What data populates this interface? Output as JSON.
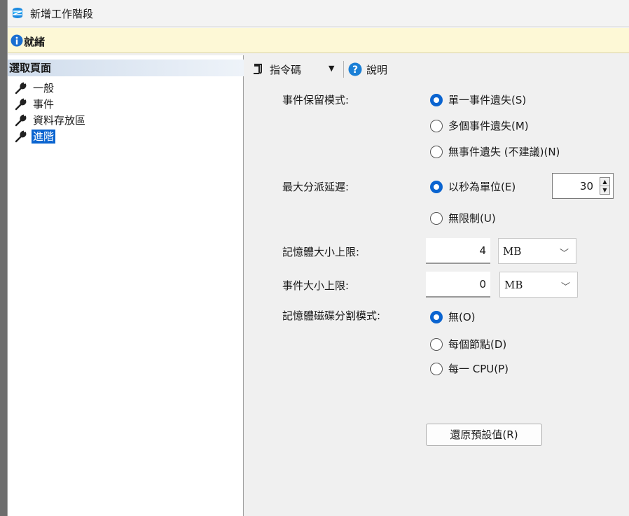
{
  "window": {
    "title": "新增工作階段"
  },
  "status": {
    "text": "就緒"
  },
  "left_pane": {
    "header": "選取頁面",
    "items": [
      {
        "label": "一般"
      },
      {
        "label": "事件"
      },
      {
        "label": "資料存放區"
      },
      {
        "label": "進階",
        "selected": true
      }
    ]
  },
  "toolbar": {
    "script_label": "指令碼",
    "help_label": "說明"
  },
  "retention": {
    "label": "事件保留模式:",
    "options": [
      "單一事件遺失(S)",
      "多個事件遺失(M)",
      "無事件遺失 (不建議)(N)"
    ],
    "selected_index": 0
  },
  "dispatch": {
    "label": "最大分派延遲:",
    "options": [
      "以秒為單位(E)",
      "無限制(U)"
    ],
    "selected_index": 0,
    "seconds_value": "30"
  },
  "memory_size": {
    "label": "記憶體大小上限:",
    "value": "4",
    "unit": "MB"
  },
  "event_size": {
    "label": "事件大小上限:",
    "value": "0",
    "unit": "MB"
  },
  "partition": {
    "label": "記憶體磁碟分割模式:",
    "options": [
      "無(O)",
      "每個節點(D)",
      "每一 CPU(P)"
    ],
    "selected_index": 0
  },
  "restore_button": "還原預設值(R)",
  "colors": {
    "accent": "#0a64d0",
    "status_bg": "#fdf8d6",
    "selection": "#0a64d0"
  }
}
